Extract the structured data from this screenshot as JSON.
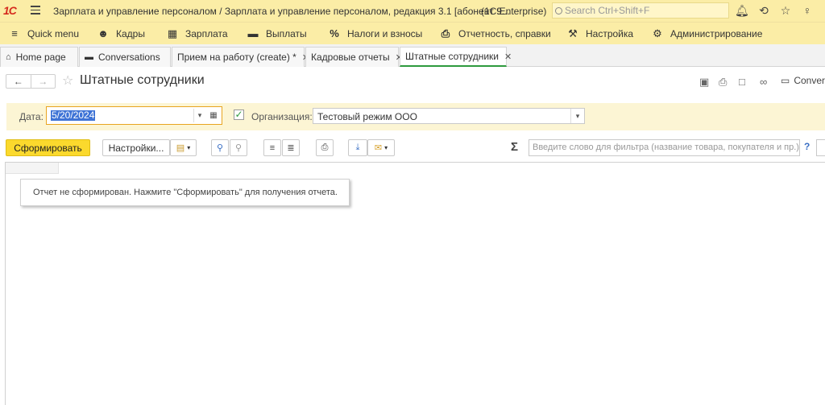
{
  "titlebar": {
    "logo": "1С",
    "title": "Зарплата и управление персоналом / Зарплата и управление персоналом, редакция 3.1 [абонент 9...",
    "app": "(1C:Enterprise)",
    "search_placeholder": "Search Ctrl+Shift+F",
    "icons": [
      "bell-icon",
      "history-icon",
      "star-icon",
      "user-icon"
    ]
  },
  "menu": {
    "items": [
      {
        "label": "Quick menu",
        "icon": "hamburger-icon"
      },
      {
        "label": "Кадры",
        "icon": "people-icon"
      },
      {
        "label": "Зарплата",
        "icon": "calculator-icon"
      },
      {
        "label": "Выплаты",
        "icon": "wallet-icon"
      },
      {
        "label": "Налоги и взносы",
        "icon": "percent-icon"
      },
      {
        "label": "Отчетность, справки",
        "icon": "reports-icon"
      },
      {
        "label": "Настройка",
        "icon": "wrench-icon"
      },
      {
        "label": "Администрирование",
        "icon": "gear-icon"
      }
    ]
  },
  "tabs": [
    {
      "label": "Home page",
      "icon": "home-icon",
      "closable": false
    },
    {
      "label": "Conversations",
      "icon": "chat-icon",
      "closable": false
    },
    {
      "label": "Прием на работу (create) *",
      "closable": true
    },
    {
      "label": "Кадровые отчеты",
      "closable": true
    },
    {
      "label": "Штатные сотрудники",
      "closable": true,
      "active": true
    }
  ],
  "form": {
    "title": "Штатные сотрудники",
    "conversations_label": "Conver"
  },
  "params": {
    "date_label": "Дата:",
    "date_value": "5/20/2024",
    "org_label": "Организация:",
    "org_checked": true,
    "org_value": "Тестовый режим ООО"
  },
  "toolbar": {
    "generate_label": "Сформировать",
    "settings_label": "Настройки...",
    "filter_placeholder": "Введите слово для фильтра (название товара, покупателя и пр.)",
    "help_label": "?"
  },
  "report": {
    "message": "Отчет не сформирован. Нажмите \"Сформировать\" для получения отчета."
  }
}
